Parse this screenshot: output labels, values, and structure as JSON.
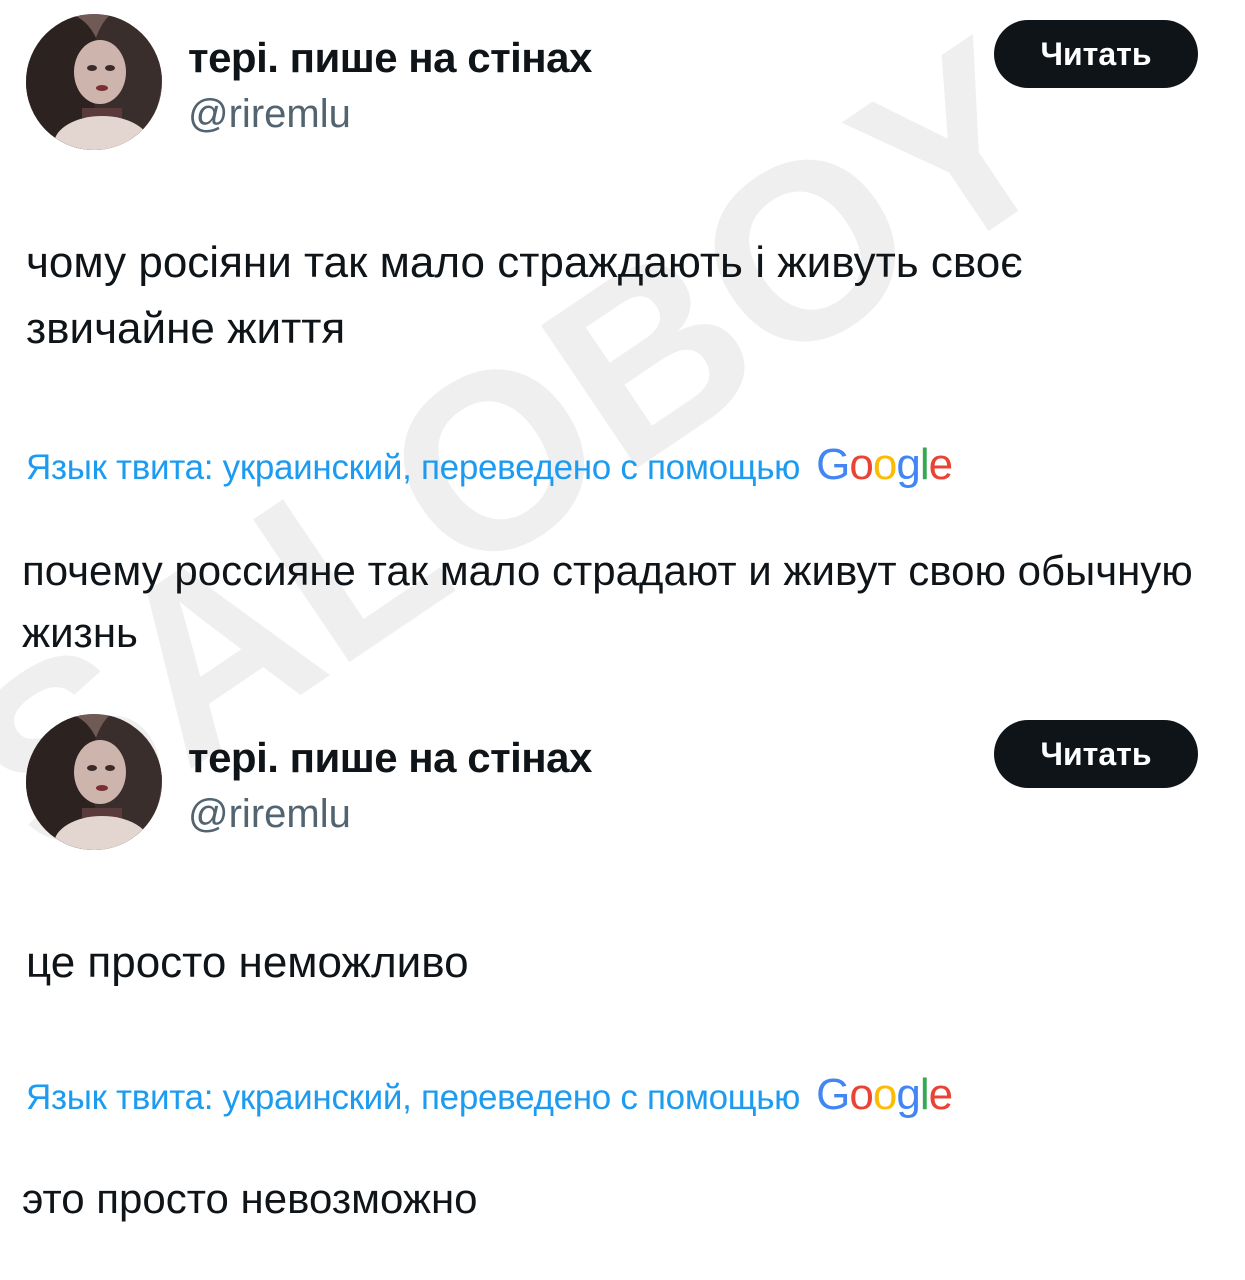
{
  "watermark": {
    "text": "SALOBOY",
    "color": "#efefef"
  },
  "tweets": [
    {
      "author": {
        "display_name": "тері. пише на стінах",
        "handle": "@riremlu"
      },
      "follow_label": "Читать",
      "text": "чому росіяни так мало страждають і живуть своє звичайне життя",
      "translation_notice": "Язык твита: украинский, переведено с помощью",
      "translation_provider": "Google",
      "translated_text": "почему россияне так мало страдают и живут свою обычную жизнь"
    },
    {
      "author": {
        "display_name": "тері. пише на стінах",
        "handle": "@riremlu"
      },
      "follow_label": "Читать",
      "text": "це просто неможливо",
      "translation_notice": "Язык твита: украинский, переведено с помощью",
      "translation_provider": "Google",
      "translated_text": "это просто невозможно"
    }
  ],
  "colors": {
    "text_primary": "#0f1419",
    "text_secondary": "#536471",
    "link_blue": "#1d9bf0",
    "button_bg": "#0f1419",
    "button_text": "#ffffff"
  }
}
